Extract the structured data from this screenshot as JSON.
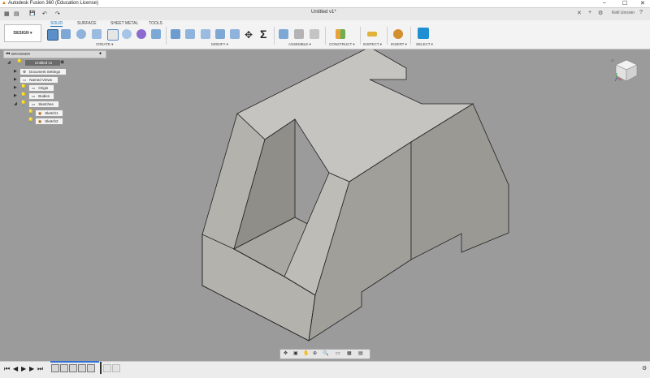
{
  "window": {
    "title": "Autodesk Fusion 360 (Education License)",
    "minimize": "–",
    "maximize": "☐",
    "close": "✕"
  },
  "quick_access": {
    "grid_icon": "▦",
    "file_icon": "▤",
    "save_icon": "💾",
    "undo_icon": "↶",
    "redo_icon": "↷"
  },
  "document_tab": {
    "name": "Untitled v1*",
    "close": "✕"
  },
  "top_right": {
    "add_tab": "+",
    "user": "Kirill Unrovin",
    "help": "?"
  },
  "workspace": {
    "label": "DESIGN ▾"
  },
  "toolbar_tabs": [
    "SOLID",
    "SURFACE",
    "SHEET METAL",
    "TOOLS"
  ],
  "tool_groups": [
    "CREATE ▾",
    "MODIFY ▾",
    "ASSEMBLE ▾",
    "CONSTRUCT ▾",
    "INSPECT ▾",
    "INSERT ▾",
    "SELECT ▾"
  ],
  "browser": {
    "title": "BROWSER",
    "root": "Untitled v1",
    "items": [
      "Document Settings",
      "Named Views",
      "Origin",
      "Bodies",
      "Sketches"
    ],
    "sketches": [
      "Sketch1",
      "Sketch2"
    ]
  },
  "colors": {
    "accent": "#1d6fb8",
    "select_tool": "#1f8fd4",
    "viewport_bg": "#9b9b9b",
    "model_top": "#c7c6c2",
    "model_front": "#b3b2ad",
    "model_side": "#969590"
  }
}
